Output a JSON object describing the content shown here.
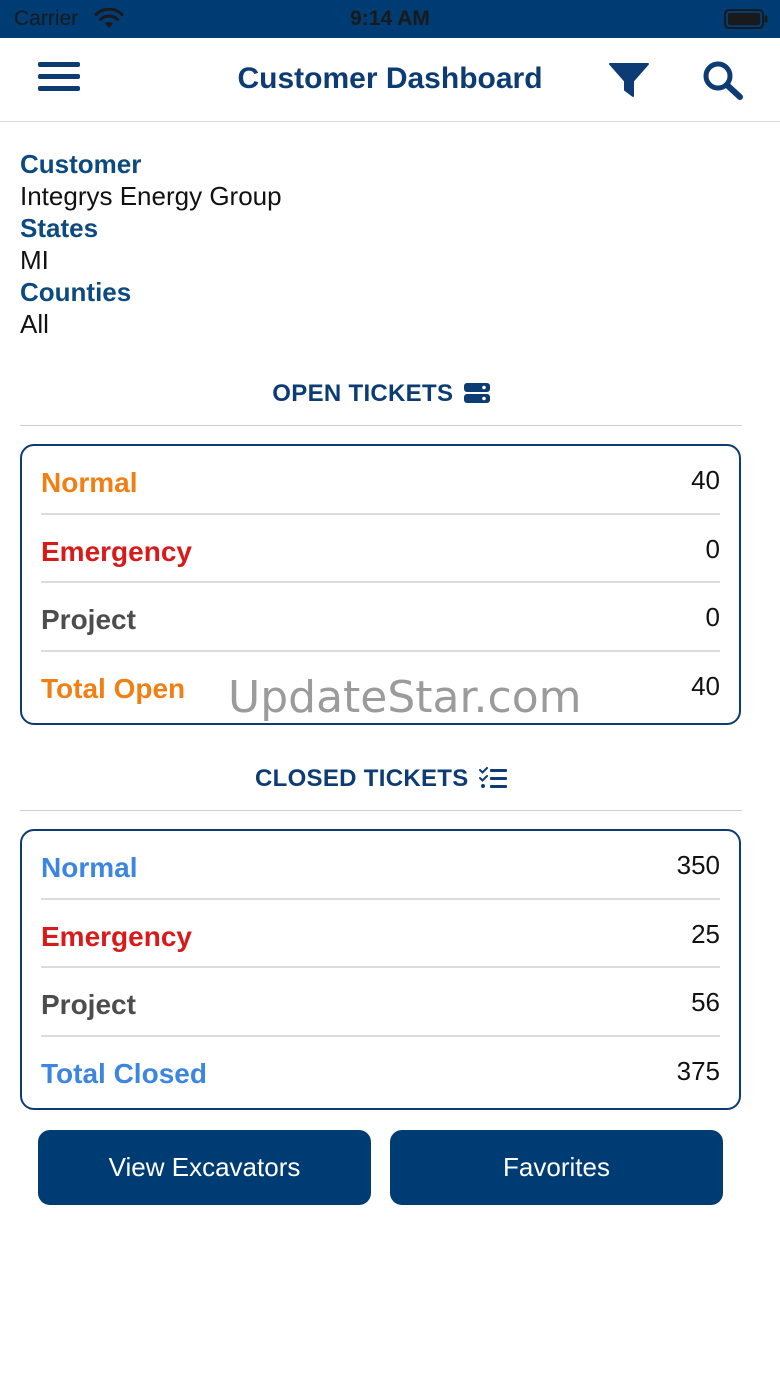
{
  "status_bar": {
    "carrier": "Carrier",
    "time": "9:14 AM",
    "wifi_icon": "wifi-icon",
    "battery_icon": "battery-icon"
  },
  "nav": {
    "title": "Customer Dashboard",
    "menu_icon": "hamburger-menu-icon",
    "filter_icon": "filter-icon",
    "search_icon": "search-icon",
    "accent_color": "#0c3c73"
  },
  "info": {
    "customer_label": "Customer",
    "customer_value": "Integrys Energy Group",
    "states_label": "States",
    "states_value": "MI",
    "counties_label": "Counties",
    "counties_value": "All"
  },
  "open_tickets": {
    "title": "OPEN TICKETS",
    "icon": "server-icon",
    "rows": [
      {
        "label": "Normal",
        "value": "40",
        "color": "#f07f14"
      },
      {
        "label": "Emergency",
        "value": "0",
        "color": "#d71b1b"
      },
      {
        "label": "Project",
        "value": "0",
        "color": "#4d4d4d"
      },
      {
        "label": "Total Open",
        "value": "40",
        "color": "#f07f14"
      }
    ]
  },
  "closed_tickets": {
    "title": "CLOSED TICKETS",
    "icon": "checklist-icon",
    "rows": [
      {
        "label": "Normal",
        "value": "350",
        "color": "#3d86e0"
      },
      {
        "label": "Emergency",
        "value": "25",
        "color": "#d71b1b"
      },
      {
        "label": "Project",
        "value": "56",
        "color": "#4d4d4d"
      },
      {
        "label": "Total Closed",
        "value": "375",
        "color": "#3d86e0"
      }
    ]
  },
  "buttons": {
    "view_excavators": "View Excavators",
    "favorites": "Favorites"
  },
  "watermark": "UpdateStar.com"
}
